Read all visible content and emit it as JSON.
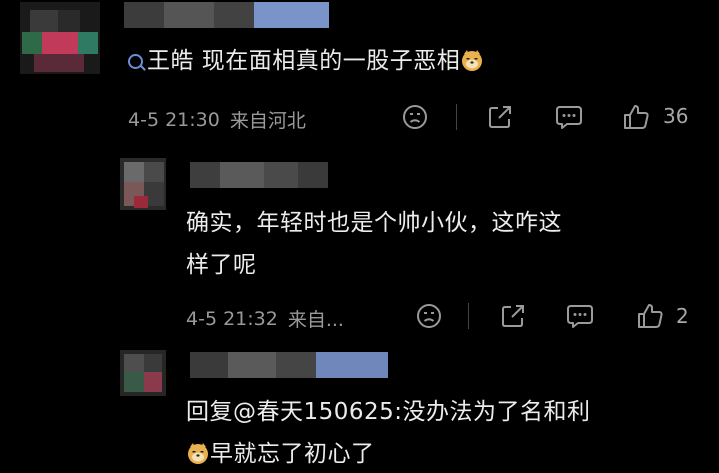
{
  "comments": [
    {
      "content_text": "王皓 现在面相真的一股子恶相",
      "timestamp": "4-5 21:30",
      "location": "来自河北",
      "like_count": "36"
    },
    {
      "content_line1": "确实，年轻时也是个帅小伙，这咋这",
      "content_line2": "样了呢",
      "timestamp": "4-5 21:32",
      "location": "来自...",
      "like_count": "2"
    },
    {
      "content_line1": "回复@春天150625:没办法为了名和利",
      "content_line2": "早就忘了初心了"
    }
  ],
  "icons": [
    "search-icon",
    "doge-emoji-icon",
    "dislike-face-icon",
    "share-icon",
    "comment-icon",
    "like-icon"
  ],
  "colors": {
    "background": "#000000",
    "text": "#ececec",
    "meta": "#9a9a9a",
    "accent": "#6d8fd8"
  }
}
